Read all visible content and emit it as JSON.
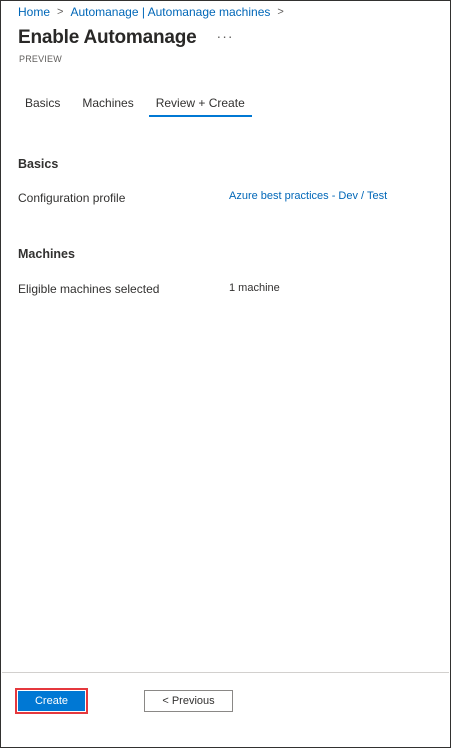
{
  "breadcrumb": {
    "items": [
      "Home",
      "Automanage | Automanage machines"
    ],
    "separator": ">"
  },
  "header": {
    "title": "Enable Automanage",
    "more_label": "···",
    "badge": "PREVIEW"
  },
  "tabs": [
    {
      "label": "Basics",
      "active": false
    },
    {
      "label": "Machines",
      "active": false
    },
    {
      "label": "Review + Create",
      "active": true
    }
  ],
  "review": {
    "basics": {
      "heading": "Basics",
      "rows": [
        {
          "label": "Configuration profile",
          "value": "Azure best practices - Dev / Test"
        }
      ]
    },
    "machines": {
      "heading": "Machines",
      "rows": [
        {
          "label": "Eligible machines selected",
          "value": "1 machine"
        }
      ]
    }
  },
  "footer": {
    "create_label": "Create",
    "previous_label": "< Previous"
  },
  "colors": {
    "accent": "#0078d4",
    "link": "#0067b8",
    "highlight": "#e5383d"
  }
}
